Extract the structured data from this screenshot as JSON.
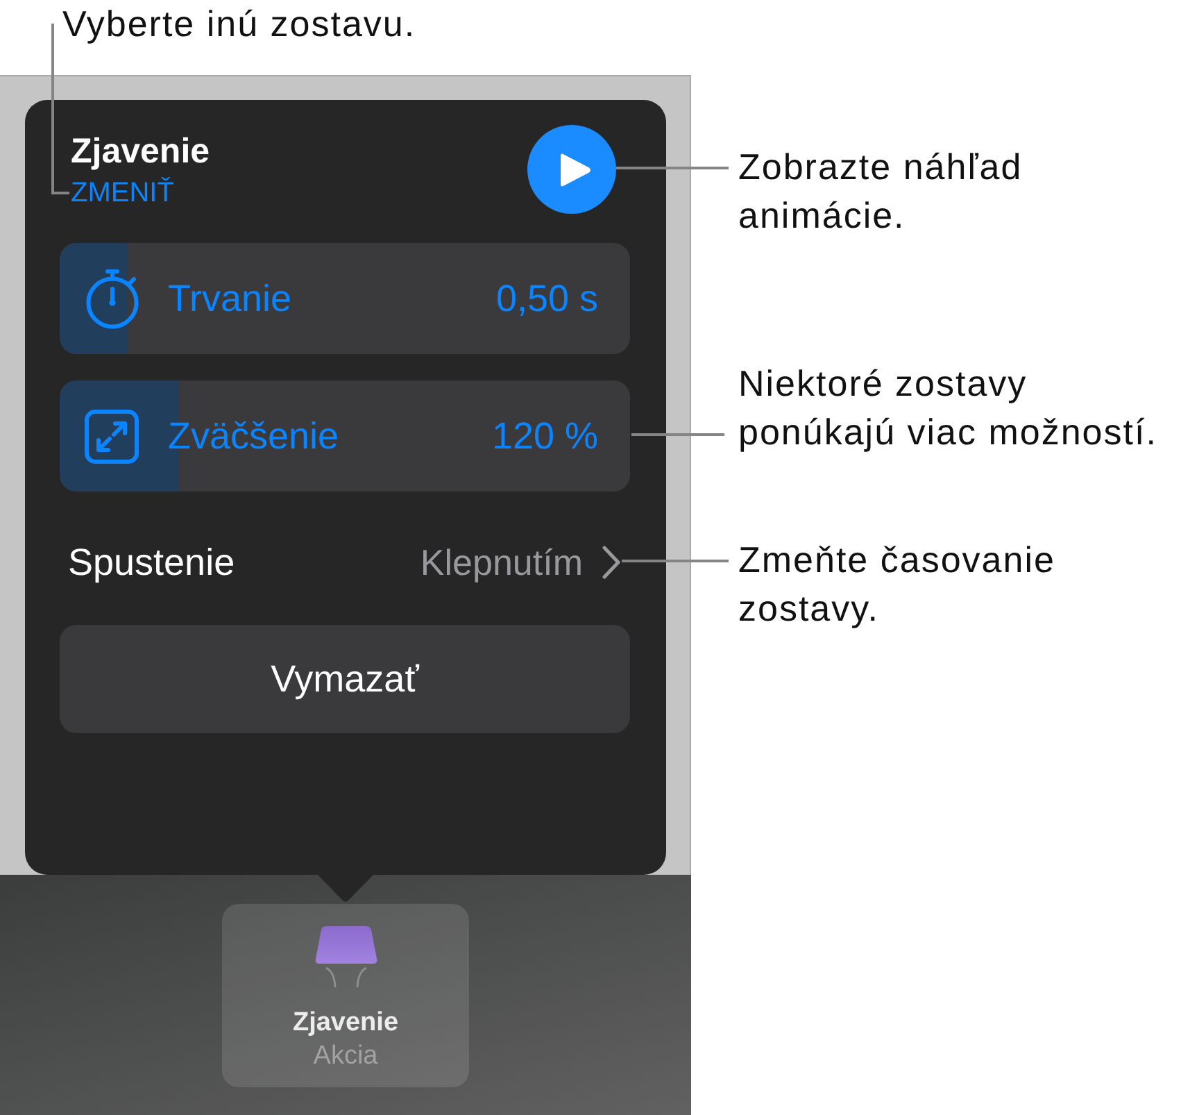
{
  "callouts": [
    "Vyberte inú zostavu.",
    "Zobrazte náhľad animácie.",
    "Niektoré zostavy ponúkajú viac možností.",
    "Zmeňte časovanie zostavy."
  ],
  "popover": {
    "title": "Zjavenie",
    "change_link": "ZMENIŤ",
    "options": [
      {
        "kind": "duration",
        "label": "Trvanie",
        "value": "0,50 s",
        "level": 0.12
      },
      {
        "kind": "scale",
        "label": "Zväčšenie",
        "value": "120 %",
        "level": 0.21
      }
    ],
    "start": {
      "label": "Spustenie",
      "value": "Klepnutím"
    },
    "delete_button": "Vymazať"
  },
  "animation_tile": {
    "title": "Zjavenie",
    "subtitle": "Akcia"
  }
}
